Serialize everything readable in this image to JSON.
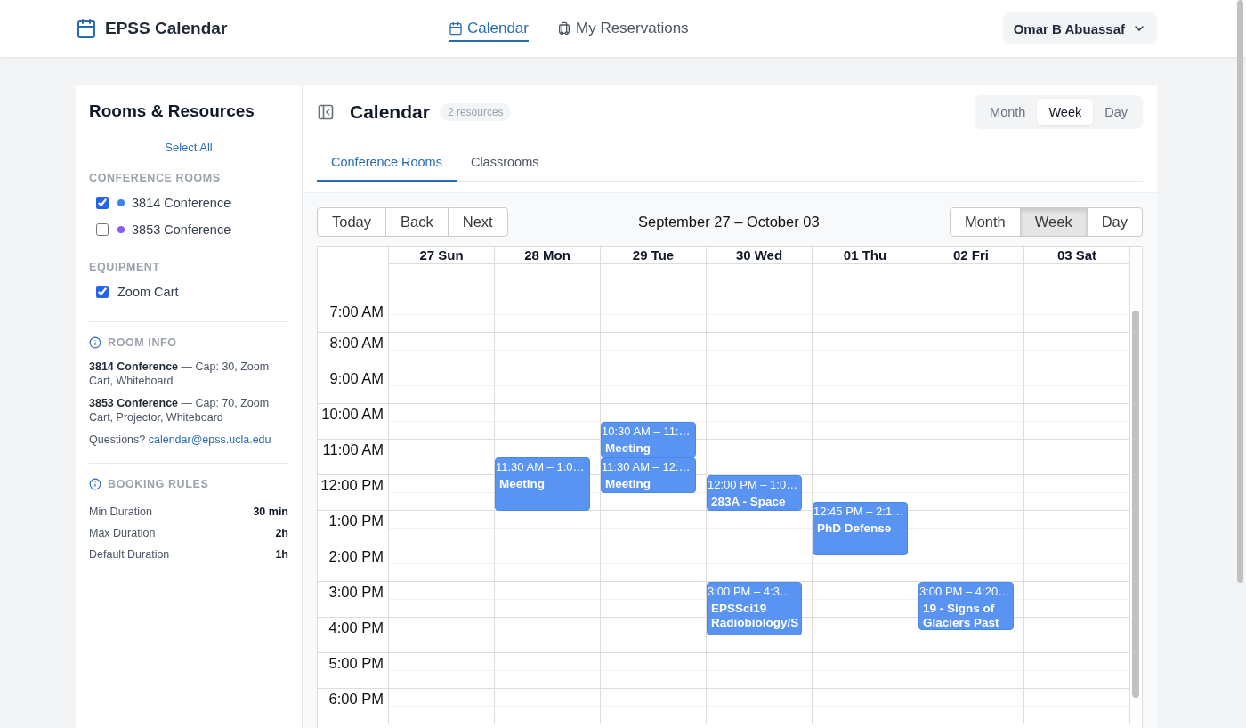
{
  "app": {
    "title": "EPSS Calendar"
  },
  "nav": [
    {
      "label": "Calendar",
      "selected": true,
      "kind": "calendar"
    },
    {
      "label": "My Reservations",
      "selected": false,
      "kind": "luggage"
    }
  ],
  "user": {
    "name": "Omar B Abuassaf"
  },
  "sidebar": {
    "title": "Rooms & Resources",
    "select_all": "Select All",
    "groups": [
      {
        "heading": "CONFERENCE ROOMS",
        "items": [
          {
            "label": "3814 Conference",
            "checked": true,
            "color": "#3b82f6"
          },
          {
            "label": "3853 Conference",
            "checked": false,
            "color": "#8b5cf6"
          }
        ]
      },
      {
        "heading": "EQUIPMENT",
        "items": [
          {
            "label": "Zoom Cart",
            "checked": true
          }
        ]
      }
    ],
    "room_info": {
      "heading": "ROOM INFO",
      "entries": [
        "**3814 Conference** — Cap: 30, Zoom Cart, Whiteboard",
        "**3853 Conference** — Cap: 70, Zoom Cart, Projector, Whiteboard"
      ],
      "questions": "Questions?",
      "email": "calendar@epss.ucla.edu"
    },
    "booking_rules": {
      "heading": "BOOKING RULES",
      "rules": [
        {
          "label": "Min Duration",
          "value": "30 min"
        },
        {
          "label": "Max Duration",
          "value": "2h"
        },
        {
          "label": "Default Duration",
          "value": "1h"
        }
      ]
    }
  },
  "calendar": {
    "title": "Calendar",
    "badge": "2 resources",
    "views": [
      {
        "label": "Month",
        "selected": false
      },
      {
        "label": "Week",
        "selected": true
      },
      {
        "label": "Day",
        "selected": false
      }
    ],
    "tabs": [
      {
        "label": "Conference Rooms",
        "selected": true
      },
      {
        "label": "Classrooms",
        "selected": false
      }
    ],
    "toolbar": {
      "nav_buttons": [
        "Today",
        "Back",
        "Next"
      ],
      "range": "September 27 – October 03",
      "views": [
        {
          "label": "Month",
          "selected": false
        },
        {
          "label": "Week",
          "selected": true
        },
        {
          "label": "Day",
          "selected": false
        }
      ]
    },
    "hours": [
      "7:00 AM",
      "8:00 AM",
      "9:00 AM",
      "10:00 AM",
      "11:00 AM",
      "12:00 PM",
      "1:00 PM",
      "2:00 PM",
      "3:00 PM",
      "4:00 PM",
      "5:00 PM",
      "6:00 PM"
    ],
    "days": [
      {
        "label": "27 Sun"
      },
      {
        "label": "28 Mon",
        "events": [
          {
            "time": "11:30 AM – 1:0…",
            "title": "Meeting"
          }
        ]
      },
      {
        "label": "29 Tue",
        "events": [
          {
            "time": "10:30 AM – 11:…",
            "title": "Meeting"
          },
          {
            "time": "11:30 AM – 12:…",
            "title": "Meeting"
          }
        ]
      },
      {
        "label": "30 Wed",
        "events": [
          {
            "time": "12:00 PM – 1:0…",
            "title": "283A - Space"
          },
          {
            "time": "3:00 PM – 4:3…",
            "title": "EPSSci19 Radiobiology/S"
          }
        ]
      },
      {
        "label": "01 Thu",
        "events": [
          {
            "time": "12:45 PM – 2:1…",
            "title": "PhD Defense"
          }
        ]
      },
      {
        "label": "02 Fri",
        "events": [
          {
            "time": "3:00 PM – 4:20…",
            "title": "19 - Signs of Glaciers Past"
          }
        ]
      },
      {
        "label": "03 Sat"
      }
    ]
  }
}
